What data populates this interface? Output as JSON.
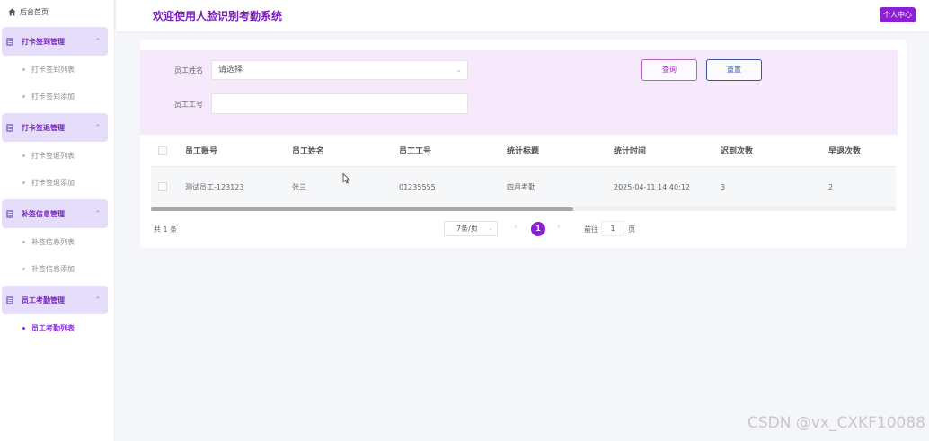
{
  "sidebar": {
    "home_label": "后台首页",
    "groups": [
      {
        "label": "打卡签到管理",
        "items": [
          "打卡签到列表",
          "打卡签到添加"
        ]
      },
      {
        "label": "打卡签退管理",
        "items": [
          "打卡签退列表",
          "打卡签退添加"
        ]
      },
      {
        "label": "补签信息管理",
        "items": [
          "补签信息列表",
          "补签信息添加"
        ]
      },
      {
        "label": "员工考勤管理",
        "items": [
          "员工考勤列表"
        ]
      }
    ],
    "active_item": "员工考勤列表"
  },
  "header": {
    "title": "欢迎使用人脸识别考勤系统",
    "user_button": "个人中心"
  },
  "filter": {
    "name_label": "员工姓名",
    "name_placeholder": "请选择",
    "id_label": "员工工号",
    "id_value": "",
    "query_button": "查询",
    "reset_button": "重置"
  },
  "table": {
    "columns": [
      "员工账号",
      "员工姓名",
      "员工工号",
      "统计标题",
      "统计时间",
      "迟到次数",
      "早退次数"
    ],
    "rows": [
      [
        "测试员工-123123",
        "张三",
        "01235555",
        "四月考勤",
        "2025-04-11 14:40:12",
        "3",
        "2"
      ]
    ]
  },
  "pagination": {
    "total_text": "共 1 条",
    "page_size": "7条/页",
    "current_page": "1",
    "goto_prefix": "前往",
    "goto_value": "1",
    "goto_suffix": "页"
  },
  "watermark": "CSDN @vx_CXKF10088",
  "colors": {
    "accent": "#8a1fd3",
    "title": "#7a1fb8",
    "filter_bg": "#f6e9fb",
    "group_bg": "#e6ddfb"
  }
}
